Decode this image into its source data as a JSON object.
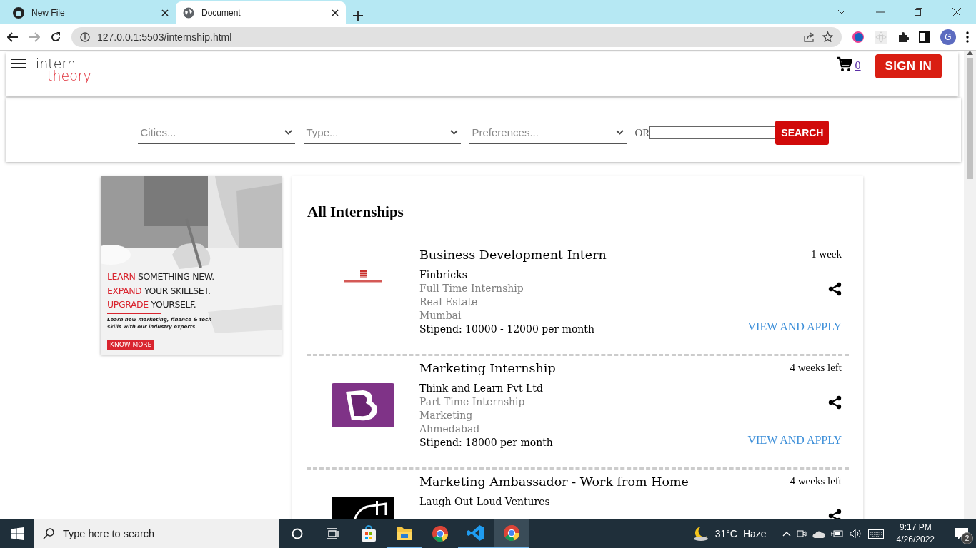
{
  "browser": {
    "tabs": [
      {
        "title": "New File",
        "kind": "github",
        "selected": false
      },
      {
        "title": "Document",
        "kind": "globe",
        "selected": true
      }
    ],
    "back_disabled": false,
    "forward_disabled": true,
    "url": "127.0.0.1:5503/internship.html",
    "profile_initial": "G"
  },
  "header": {
    "logo_top": "intern",
    "logo_bottom": "theory",
    "cart_count": "0",
    "sign_in": "SIGN IN"
  },
  "filters": {
    "dropdowns": [
      {
        "placeholder": "Cities..."
      },
      {
        "placeholder": "Type..."
      },
      {
        "placeholder": "Preferences..."
      }
    ],
    "or_label": "OR",
    "search_button": "SEARCH"
  },
  "ad": {
    "kind": "picture",
    "headlines": [
      {
        "accent": "LEARN",
        "rest": "SOMETHING NEW."
      },
      {
        "accent": "EXPAND",
        "rest": "YOUR SKILLSET."
      },
      {
        "accent": "UPGRADE",
        "rest": "YOURSELF."
      }
    ],
    "text": "Learn new marketing, finance & tech skills with our industry experts",
    "button": "KNOW MORE"
  },
  "internships": {
    "title": "All Internships",
    "items": [
      {
        "kind": "bricks",
        "title": "Business Development Intern",
        "duration": "1 week",
        "company": "Finbricks",
        "type": "Full Time Internship",
        "category": "Real Estate",
        "city": "Mumbai",
        "stipend": "Stipend: 10000 - 12000 per month",
        "action": "VIEW AND APPLY"
      },
      {
        "kind": "letter-mark",
        "title": "Marketing Internship",
        "duration": "4 weeks left",
        "company": "Think and Learn Pvt Ltd",
        "type": "Part Time Internship",
        "category": "Marketing",
        "city": "Ahmedabad",
        "stipend": "Stipend: 18000 per month",
        "action": "VIEW AND APPLY"
      },
      {
        "kind": "dark-mark",
        "title": "Marketing Ambassador - Work from Home",
        "duration": "4 weeks left",
        "company": "Laugh Out Loud Ventures"
      }
    ]
  },
  "taskbar": {
    "search_placeholder": "Type here to search",
    "apps": [
      {
        "kind": "store",
        "running": false,
        "selected": false
      },
      {
        "kind": "folder",
        "running": true,
        "selected": false
      },
      {
        "kind": "chrome",
        "running": false,
        "selected": false
      },
      {
        "kind": "vscode",
        "running": true,
        "selected": false
      },
      {
        "kind": "chrome",
        "running": true,
        "selected": true
      }
    ],
    "temperature": "31°C",
    "weather": "Haze",
    "time": "9:17 PM",
    "date": "4/26/2022",
    "notifications": "2"
  }
}
